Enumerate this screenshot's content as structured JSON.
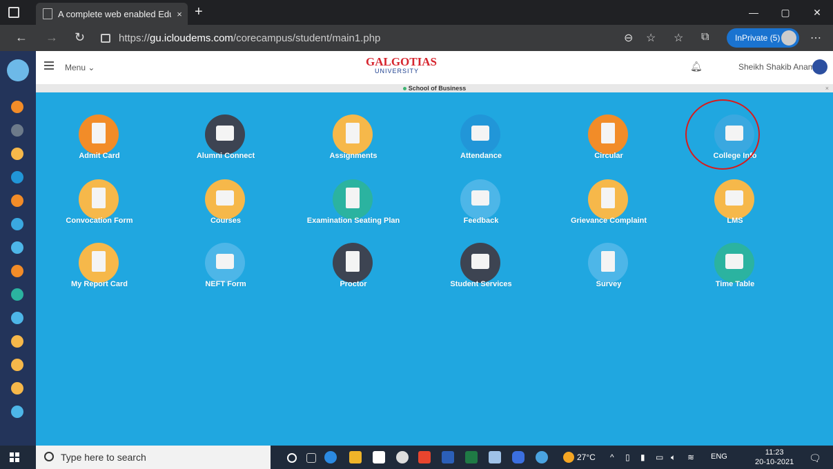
{
  "browser": {
    "tab_title": "A complete web enabled Educat",
    "tab_close": "×",
    "new_tab": "+",
    "url_prefix": "https://",
    "url_domain": "gu.icloudems.com",
    "url_path": "/corecampus/student/main1.php",
    "inprivate_label": "InPrivate (5)",
    "window_minimize": "—",
    "window_restore": "▢",
    "window_close": "✕"
  },
  "header": {
    "menu_label": "Menu ⌄",
    "logo_top": "GALGOTIAS",
    "logo_bottom": "UNIVERSITY",
    "user_name": "Sheikh Shakib Anam"
  },
  "school_bar": {
    "label": "School of Business",
    "close": "×"
  },
  "tiles": [
    {
      "label": "Admit Card",
      "color": "#f28c28"
    },
    {
      "label": "Alumni Connect",
      "color": "#3d4452"
    },
    {
      "label": "Assignments",
      "color": "#f6b84a"
    },
    {
      "label": "Attendance",
      "color": "#2196d8"
    },
    {
      "label": "Circular",
      "color": "#f28c28"
    },
    {
      "label": "College Info",
      "color": "#3aa8e0"
    },
    {
      "label": "Convocation Form",
      "color": "#f6b84a"
    },
    {
      "label": "Courses",
      "color": "#f6b84a"
    },
    {
      "label": "Examination Seating Plan",
      "color": "#2bb3a0"
    },
    {
      "label": "Feedback",
      "color": "#4db6e8"
    },
    {
      "label": "Grievance Complaint",
      "color": "#f6b84a"
    },
    {
      "label": "LMS",
      "color": "#f6b84a"
    },
    {
      "label": "My Report Card",
      "color": "#f6b84a"
    },
    {
      "label": "NEFT Form",
      "color": "#4db6e8"
    },
    {
      "label": "Proctor",
      "color": "#3d4452"
    },
    {
      "label": "Student Services",
      "color": "#3d4452"
    },
    {
      "label": "Survey",
      "color": "#4db6e8"
    },
    {
      "label": "Time Table",
      "color": "#2bb3a0"
    }
  ],
  "taskbar": {
    "search_placeholder": "Type here to search",
    "weather": "27°C",
    "lang": "ENG",
    "time": "11:23",
    "date": "20-10-2021"
  },
  "colors": {
    "main_bg": "#20a7e0",
    "rail_bg": "#23345a",
    "highlight": "#d81b1b"
  }
}
